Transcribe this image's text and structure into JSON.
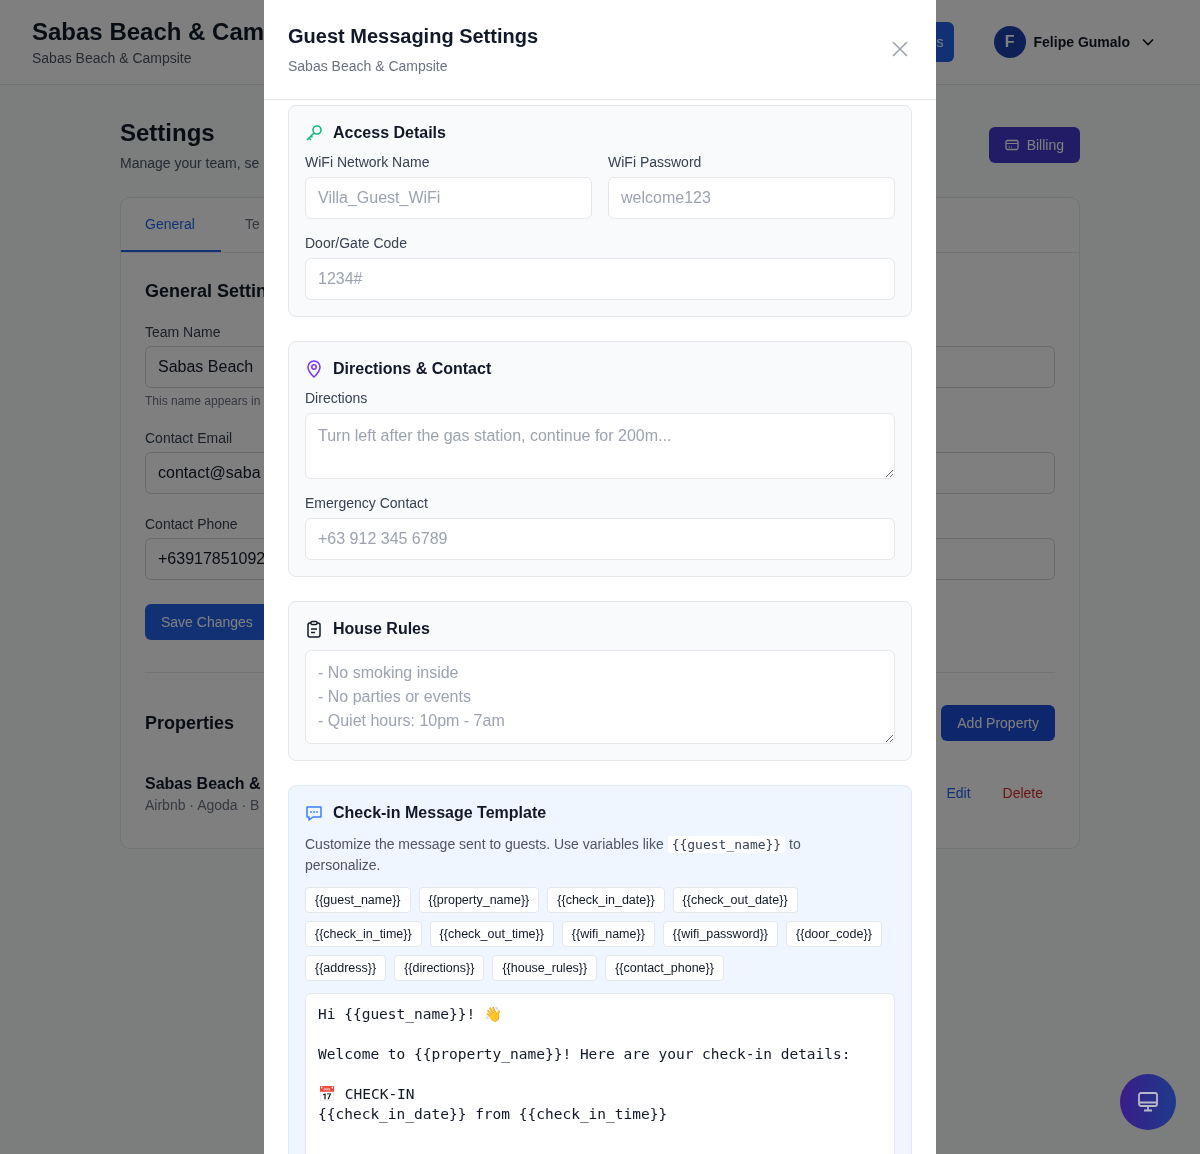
{
  "header": {
    "title": "Sabas Beach & Cam",
    "subtitle": "Sabas Beach & Campsite",
    "action_button": "s",
    "user": {
      "initial": "F",
      "name": "Felipe Gumalo"
    }
  },
  "page": {
    "title": "Settings",
    "subtitle": "Manage your team, se",
    "billing_button": "Billing",
    "tabs": [
      {
        "label": "General",
        "selected": true
      },
      {
        "label": "Te",
        "selected": false
      }
    ],
    "section_title": "General Settin",
    "fields": [
      {
        "label": "Team Name",
        "value": "Sabas Beach",
        "hint": "This name appears in"
      },
      {
        "label": "Contact Email",
        "value": "contact@saba"
      },
      {
        "label": "Contact Phone",
        "value": "+63917851092"
      }
    ],
    "save_button": "Save Changes",
    "properties": {
      "title": "Properties",
      "add_button": "Add Property",
      "items": [
        {
          "name": "Sabas Beach &",
          "channels": "Airbnb · Agoda · B",
          "edit": "Edit",
          "delete": "Delete"
        }
      ]
    }
  },
  "modal": {
    "title": "Guest Messaging Settings",
    "subtitle": "Sabas Beach & Campsite",
    "sections": [
      {
        "kind": "access",
        "title": "Access Details",
        "rows": [
          [
            {
              "kind": "input",
              "label": "WiFi Network Name",
              "placeholder": "Villa_Guest_WiFi"
            },
            {
              "kind": "input",
              "label": "WiFi Password",
              "placeholder": "welcome123"
            }
          ],
          [
            {
              "kind": "input",
              "label": "Door/Gate Code",
              "placeholder": "1234#"
            }
          ]
        ]
      },
      {
        "kind": "directions",
        "title": "Directions & Contact",
        "rows": [
          [
            {
              "kind": "textarea",
              "label": "Directions",
              "placeholder": "Turn left after the gas station, continue for 200m..."
            }
          ],
          [
            {
              "kind": "input",
              "label": "Emergency Contact",
              "placeholder": "+63 912 345 6789"
            }
          ]
        ]
      },
      {
        "kind": "rules",
        "title": "House Rules",
        "rows": [
          [
            {
              "kind": "textarea",
              "placeholder": "- No smoking inside\n- No parties or events\n- Quiet hours: 10pm - 7am"
            }
          ]
        ]
      },
      {
        "kind": "template",
        "title": "Check-in Message Template",
        "description_before": "Customize the message sent to guests. Use variables like",
        "description_code": "{{guest_name}}",
        "description_after": "to personalize.",
        "variables": [
          "{{guest_name}}",
          "{{property_name}}",
          "{{check_in_date}}",
          "{{check_out_date}}",
          "{{check_in_time}}",
          "{{check_out_time}}",
          "{{wifi_name}}",
          "{{wifi_password}}",
          "{{door_code}}",
          "{{address}}",
          "{{directions}}",
          "{{house_rules}}",
          "{{contact_phone}}"
        ],
        "template_text": "Hi {{guest_name}}! 👋\n\nWelcome to {{property_name}}! Here are your check-in details:\n\n📅 CHECK-IN\n{{check_in_date}} from {{check_in_time}}"
      }
    ]
  }
}
